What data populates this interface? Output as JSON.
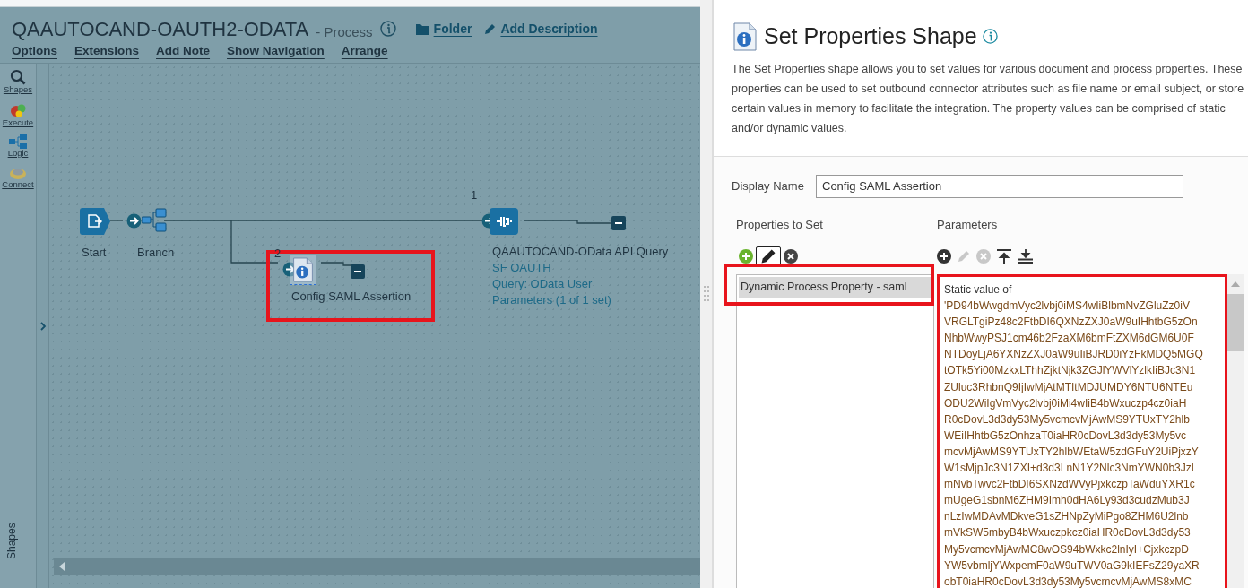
{
  "header": {
    "title": "QAAUTOCAND-OAUTH2-ODATA",
    "subtitle": "- Process",
    "links": [
      {
        "kind": "folder",
        "label": "Folder"
      },
      {
        "kind": "edit",
        "label": "Add Description"
      }
    ]
  },
  "menu": [
    "Options",
    "Extensions",
    "Add Note",
    "Show Navigation",
    "Arrange"
  ],
  "toolbox": [
    {
      "kind": "search",
      "label": "Shapes"
    },
    {
      "kind": "execute",
      "label": "Execute"
    },
    {
      "kind": "logic",
      "label": "Logic"
    },
    {
      "kind": "connect",
      "label": "Connect"
    }
  ],
  "toolbox_footer": "Shapes",
  "diagram": {
    "nodes": [
      {
        "kind": "start",
        "label": "Start"
      },
      {
        "kind": "branch",
        "label": "Branch"
      },
      {
        "kind": "setprops",
        "path": "2",
        "label": "Config SAML Assertion",
        "selected": true,
        "highlighted": true
      },
      {
        "kind": "connector",
        "path": "1",
        "label": "QAAUTOCAND-OData API Query",
        "details": [
          "SF OAUTH",
          "Query: OData User",
          "Parameters (1 of 1 set)"
        ]
      }
    ]
  },
  "panel": {
    "title": "Set Properties Shape",
    "description": "The Set Properties shape allows you to set values for various document and process properties. These properties can be used to set outbound connector attributes such as file name or email subject, or store certain values in memory to facilitate the integration. The property values can be comprised of static and/or dynamic values.",
    "display_name": {
      "label": "Display Name",
      "value": "Config SAML Assertion"
    },
    "properties": {
      "heading": "Properties to Set",
      "tools": [
        {
          "kind": "add",
          "selected": false,
          "disabled": false
        },
        {
          "kind": "edit",
          "selected": true,
          "disabled": false
        },
        {
          "kind": "delete",
          "selected": false,
          "disabled": false
        }
      ],
      "items": [
        {
          "label": "Dynamic Process Property - saml",
          "selected": true,
          "highlighted": true
        }
      ]
    },
    "parameters": {
      "heading": "Parameters",
      "tools": [
        {
          "kind": "add",
          "disabled": false
        },
        {
          "kind": "edit",
          "disabled": true
        },
        {
          "kind": "delete",
          "disabled": true
        },
        {
          "kind": "top",
          "disabled": false
        },
        {
          "kind": "bottom",
          "disabled": false
        }
      ],
      "highlighted": true,
      "lines": [
        "Static value of",
        "'PD94bWwgdmVyc2lvbj0iMS4wIiBlbmNvZGluZz0iV",
        "VRGLTgiPz48c2FtbDI6QXNzZXJ0aW9uIHhtbG5zOn",
        "NhbWwyPSJ1cm46b2FzaXM6bmFtZXM6dGM6U0F",
        "NTDoyLjA6YXNzZXJ0aW9uIiBJRD0iYzFkMDQ5MGQ",
        "tOTk5Yi00MzkxLThhZjktNjk3ZGJlYWVlYzlkIiBJc3N1",
        "ZUluc3RhbnQ9IjIwMjAtMTItMDJUMDY6NTU6NTEu",
        "ODU2WiIgVmVyc2lvbj0iMi4wIiB4bWxuczp4cz0iaH",
        "R0cDovL3d3dy53My5vcmcvMjAwMS9YTUxTY2hlb",
        "WEiIHhtbG5zOnhzaT0iaHR0cDovL3d3dy53My5vc",
        "mcvMjAwMS9YTUxTY2hlbWEtaW5zdGFuY2UiPjxzY",
        "W1sMjpJc3N1ZXI+d3d3LnN1Y2Nlc3NmYWN0b3JzL",
        "mNvbTwvc2FtbDI6SXNzdWVyPjxkczpTaWduYXR1c",
        "mUgeG1sbnM6ZHM9Imh0dHA6Ly93d3cudzMub3J",
        "nLzIwMDAvMDkveG1sZHNpZyMiPgo8ZHM6U2lnb",
        "mVkSW5mbyB4bWxuczpkcz0iaHR0cDovL3d3dy53",
        "My5vcmcvMjAwMC8wOS94bWxkc2lnIyI+CjxkczpD",
        "YW5vbmljYWxpemF0aW9uTWV0aG9kIEFsZ29yaXR",
        "obT0iaHR0cDovL3d3dy53My5vcmcvMjAwMS8xMC"
      ]
    }
  }
}
